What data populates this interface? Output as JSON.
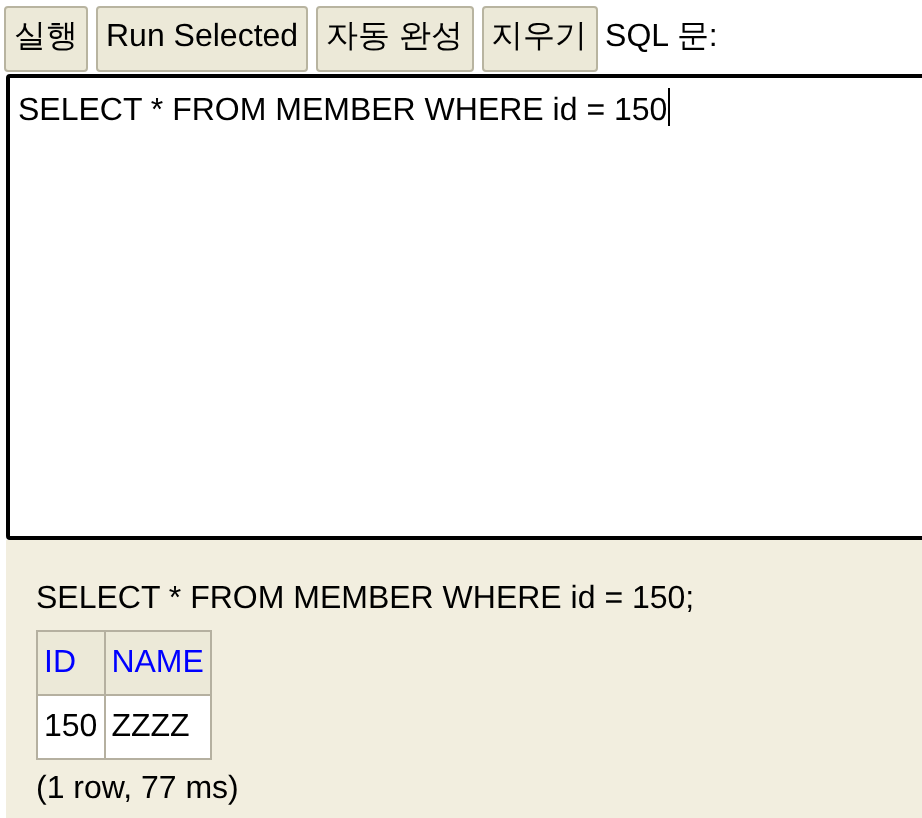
{
  "toolbar": {
    "buttons": [
      {
        "label": "실행"
      },
      {
        "label": "Run Selected"
      },
      {
        "label": "자동 완성"
      },
      {
        "label": "지우기"
      }
    ],
    "label": "SQL 문:"
  },
  "editor": {
    "value": "SELECT * FROM MEMBER WHERE id = 150"
  },
  "result": {
    "statement": "SELECT * FROM MEMBER WHERE id = 150;",
    "columns": [
      "ID",
      "NAME"
    ],
    "rows": [
      [
        "150",
        "ZZZZ"
      ]
    ],
    "summary": "(1 row, 77 ms)"
  }
}
